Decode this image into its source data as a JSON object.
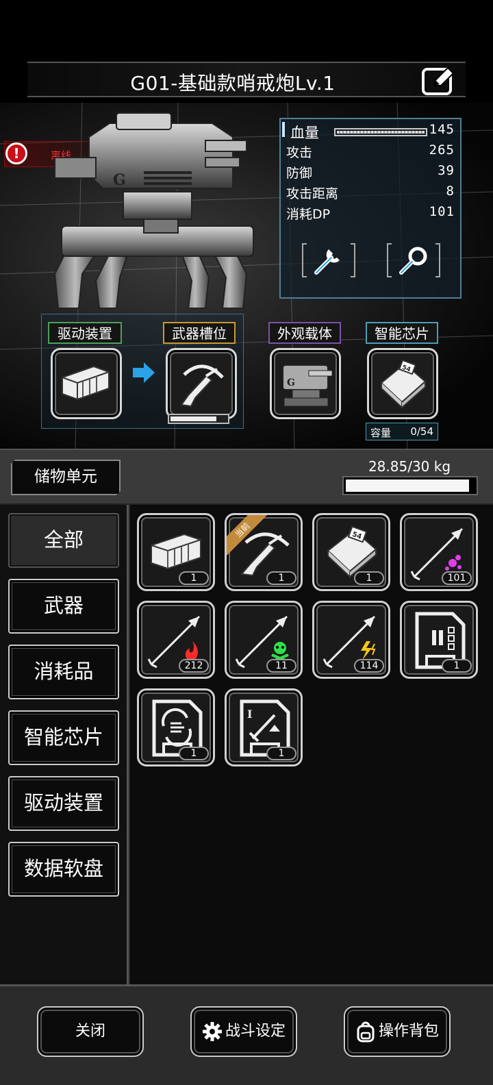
{
  "header": {
    "title": "G01-基础款哨戒炮Lv.1",
    "edit_icon": "edit-icon"
  },
  "status": {
    "label": "离线",
    "icon": "alert-icon",
    "color": "#ff2d2d"
  },
  "stats": {
    "hp_label": "血量",
    "hp_value": "145",
    "hp_fill": 1.0,
    "rows": [
      {
        "label": "攻击",
        "value": "265"
      },
      {
        "label": "防御",
        "value": "39"
      },
      {
        "label": "攻击距离",
        "value": "8"
      },
      {
        "label": "消耗DP",
        "value": "101"
      }
    ],
    "buttons": [
      "wrench-icon",
      "magnifier-icon"
    ]
  },
  "equipment": {
    "drive_label": "驱动装置",
    "weapon_label": "武器槽位",
    "appearance_label": "外观载体",
    "chip_label": "智能芯片",
    "weapon_progress": 0.82,
    "capacity_label": "容量",
    "capacity_value": "0/54"
  },
  "storage": {
    "title": "储物单元",
    "weight_text": "28.85/30 kg",
    "weight_fill": 0.96,
    "categories": [
      "全部",
      "武器",
      "消耗品",
      "智能芯片",
      "驱动装置",
      "数据软盘"
    ],
    "active_category": "全部",
    "current_badge": "当前",
    "items": [
      {
        "icon": "drive-device-icon",
        "count": "1"
      },
      {
        "icon": "crossbow-icon",
        "count": "1",
        "current": true
      },
      {
        "icon": "chip-icon",
        "count": "1",
        "chip_text": "54"
      },
      {
        "icon": "arrow-magic-icon",
        "count": "101"
      },
      {
        "icon": "arrow-fire-icon",
        "count": "212"
      },
      {
        "icon": "arrow-poison-icon",
        "count": "11"
      },
      {
        "icon": "arrow-lightning-icon",
        "count": "114"
      },
      {
        "icon": "disk-plug-icon",
        "count": "1"
      },
      {
        "icon": "disk-refresh-icon",
        "count": "1"
      },
      {
        "icon": "disk-sword-icon",
        "count": "1"
      }
    ]
  },
  "footer": {
    "close_label": "关闭",
    "battle_label": "战斗设定",
    "backpack_label": "操作背包"
  },
  "colors": {
    "accent_blue": "#29a3e6",
    "fire": "#ff2a2a",
    "poison": "#2ee04a",
    "lightning": "#f5c518",
    "magic": "#e040e8",
    "badge": "#c28a3a"
  }
}
